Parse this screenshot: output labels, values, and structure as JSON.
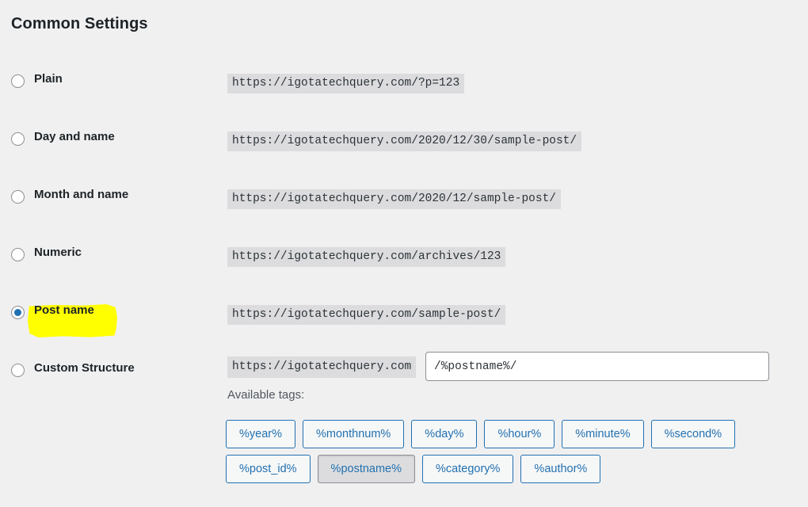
{
  "page": {
    "title": "Common Settings",
    "site_base": "https://igotatechquery.com"
  },
  "permalink_options": [
    {
      "id": "plain",
      "label": "Plain",
      "example_url": "https://igotatechquery.com/?p=123",
      "selected": false
    },
    {
      "id": "day-and-name",
      "label": "Day and name",
      "example_url": "https://igotatechquery.com/2020/12/30/sample-post/",
      "selected": false
    },
    {
      "id": "month-and-name",
      "label": "Month and name",
      "example_url": "https://igotatechquery.com/2020/12/sample-post/",
      "selected": false
    },
    {
      "id": "numeric",
      "label": "Numeric",
      "example_url": "https://igotatechquery.com/archives/123",
      "selected": false
    },
    {
      "id": "post-name",
      "label": "Post name",
      "example_url": "https://igotatechquery.com/sample-post/",
      "selected": true,
      "highlighted": true,
      "highlight_color": "#ffff00"
    },
    {
      "id": "custom-structure",
      "label": "Custom Structure",
      "example_url": "https://igotatechquery.com",
      "selected": false
    }
  ],
  "custom_structure": {
    "prefix": "https://igotatechquery.com",
    "value": "/%postname%/",
    "placeholder": "/%postname%/"
  },
  "available_tags": {
    "label": "Available tags:",
    "rows": [
      [
        {
          "label": "%year%",
          "active": false
        },
        {
          "label": "%monthnum%",
          "active": false
        },
        {
          "label": "%day%",
          "active": false
        },
        {
          "label": "%hour%",
          "active": false
        },
        {
          "label": "%minute%",
          "active": false
        },
        {
          "label": "%second%",
          "active": false
        }
      ],
      [
        {
          "label": "%post_id%",
          "active": false
        },
        {
          "label": "%postname%",
          "active": true
        },
        {
          "label": "%category%",
          "active": false
        },
        {
          "label": "%author%",
          "active": false
        }
      ]
    ]
  },
  "colors": {
    "background": "#f0f0f1",
    "text": "#1d2327",
    "accent": "#2271b1",
    "code_bg": "#dcdcde",
    "highlight": "#ffff00",
    "border": "#8c8f94"
  }
}
